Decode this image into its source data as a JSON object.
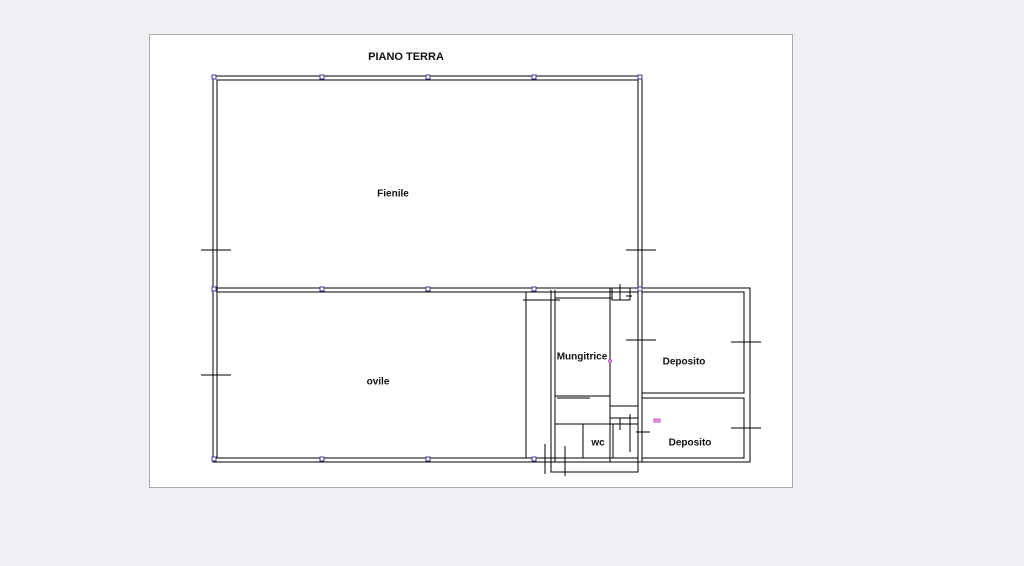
{
  "plan": {
    "title": "PIANO TERRA",
    "rooms": {
      "fienile": "Fienile",
      "ovile": "ovile",
      "mungitrice": "Mungitrice",
      "deposito_1": "Deposito",
      "deposito_2": "Deposito",
      "wc": "wc"
    }
  },
  "colors": {
    "page_background": "#eef0f5",
    "sheet": "#ffffff",
    "wall": "#000000",
    "column_marker": "#3a3aa0",
    "detail_marker": "#c050c0"
  }
}
